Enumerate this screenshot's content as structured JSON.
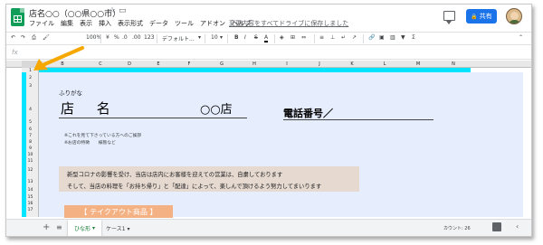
{
  "window": {
    "title": "店名○○（○○県○○市）",
    "save_status": "変更内容をすべてドライブに保存しました"
  },
  "menu": [
    "ファイル",
    "編集",
    "表示",
    "挿入",
    "表示形式",
    "データ",
    "ツール",
    "アドオン",
    "ヘルプ"
  ],
  "header": {
    "share_label": "共有"
  },
  "toolbar": {
    "zoom": "100%",
    "currency": "¥",
    "percent": "%",
    "decimal_less": ".0",
    "decimal_more": ".00",
    "number_format": "123",
    "font": "デフォルト...",
    "font_size": "10",
    "bold": "B",
    "italic": "I",
    "strike": "S",
    "text_color": "A"
  },
  "columns": [
    "B",
    "C",
    "D",
    "E",
    "F",
    "G",
    "H",
    "I",
    "J",
    "K",
    "L",
    "M",
    "N"
  ],
  "rows": [
    "1",
    "2",
    "3",
    "4",
    "5",
    "6",
    "7",
    "8",
    "9",
    "10",
    "11",
    "12",
    "13",
    "14",
    "15",
    "16",
    "17",
    "18"
  ],
  "sheet": {
    "furigana": "ふりがな",
    "store_name": "店 名",
    "store_suffix": "○○店",
    "phone_label": "電話番号／",
    "note_1": "※これを見て下さっている方へのご挨拶",
    "note_2": "※お店の特徴　　様態など",
    "message_1": "新型コロナの影響を受け、当店は店内にお客様を迎えての営業は、自粛しております",
    "message_2": "そして、当店の料理を「お持ち帰り」と「配達」によって、楽しんで頂けるよう努力してまいります",
    "takeout_heading": "【 テイクアウト商品 】"
  },
  "tabs": {
    "active": "ひな形",
    "inactive": "ケース1"
  },
  "status": {
    "count": "カウント: 26"
  },
  "colors": {
    "accent": "#1a73e8",
    "highlight_cyan": "#00e5ff",
    "sheet_bg": "#e6edfc",
    "message_bg": "#e6d9cf",
    "takeout_bg": "#f4b183",
    "arrow": "#f6a800"
  }
}
